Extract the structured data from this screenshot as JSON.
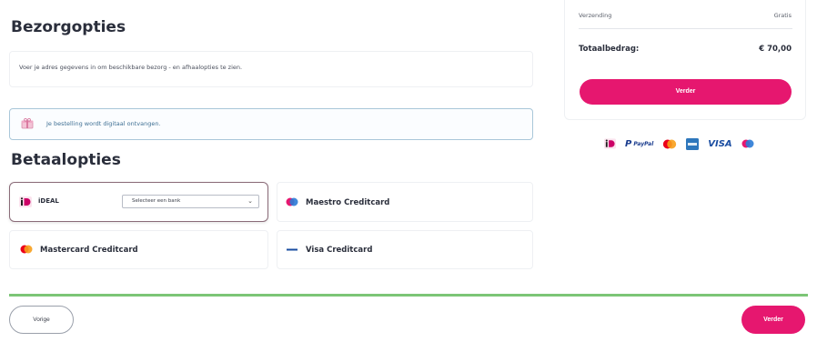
{
  "shipping": {
    "title": "Bezorgopties",
    "description": "Voer je adres gegevens in om beschikbare bezorg - en afhaalopties te zien.",
    "info_message": "Je bestelling wordt digitaal ontvangen."
  },
  "payment": {
    "title": "Betaalopties",
    "options": [
      {
        "label": "iDEAL",
        "icon": "ideal-icon"
      },
      {
        "label": "Maestro Creditcard",
        "icon": "maestro-icon"
      },
      {
        "label": "Mastercard Creditcard",
        "icon": "mastercard-icon"
      },
      {
        "label": "Visa Creditcard",
        "icon": "visa-icon"
      }
    ],
    "bank_select": {
      "value": "Selecteer een bank"
    }
  },
  "summary": {
    "shipping_label": "Verzending",
    "shipping_value": "Gratis",
    "total_label": "Totaalbedrag:",
    "total_value": "€ 70,00",
    "continue_label": "Verder",
    "payment_logos": [
      "ideal-icon",
      "paypal-icon",
      "mastercard-icon",
      "amex-icon",
      "visa-icon",
      "maestro-icon"
    ],
    "paypal_text": "PayPal",
    "visa_text": "VISA"
  },
  "footer": {
    "previous_label": "Vorige",
    "next_label": "Verder"
  },
  "colors": {
    "accent": "#e6176f",
    "progress": "#7cc576",
    "info_border": "#a9c7d9"
  }
}
